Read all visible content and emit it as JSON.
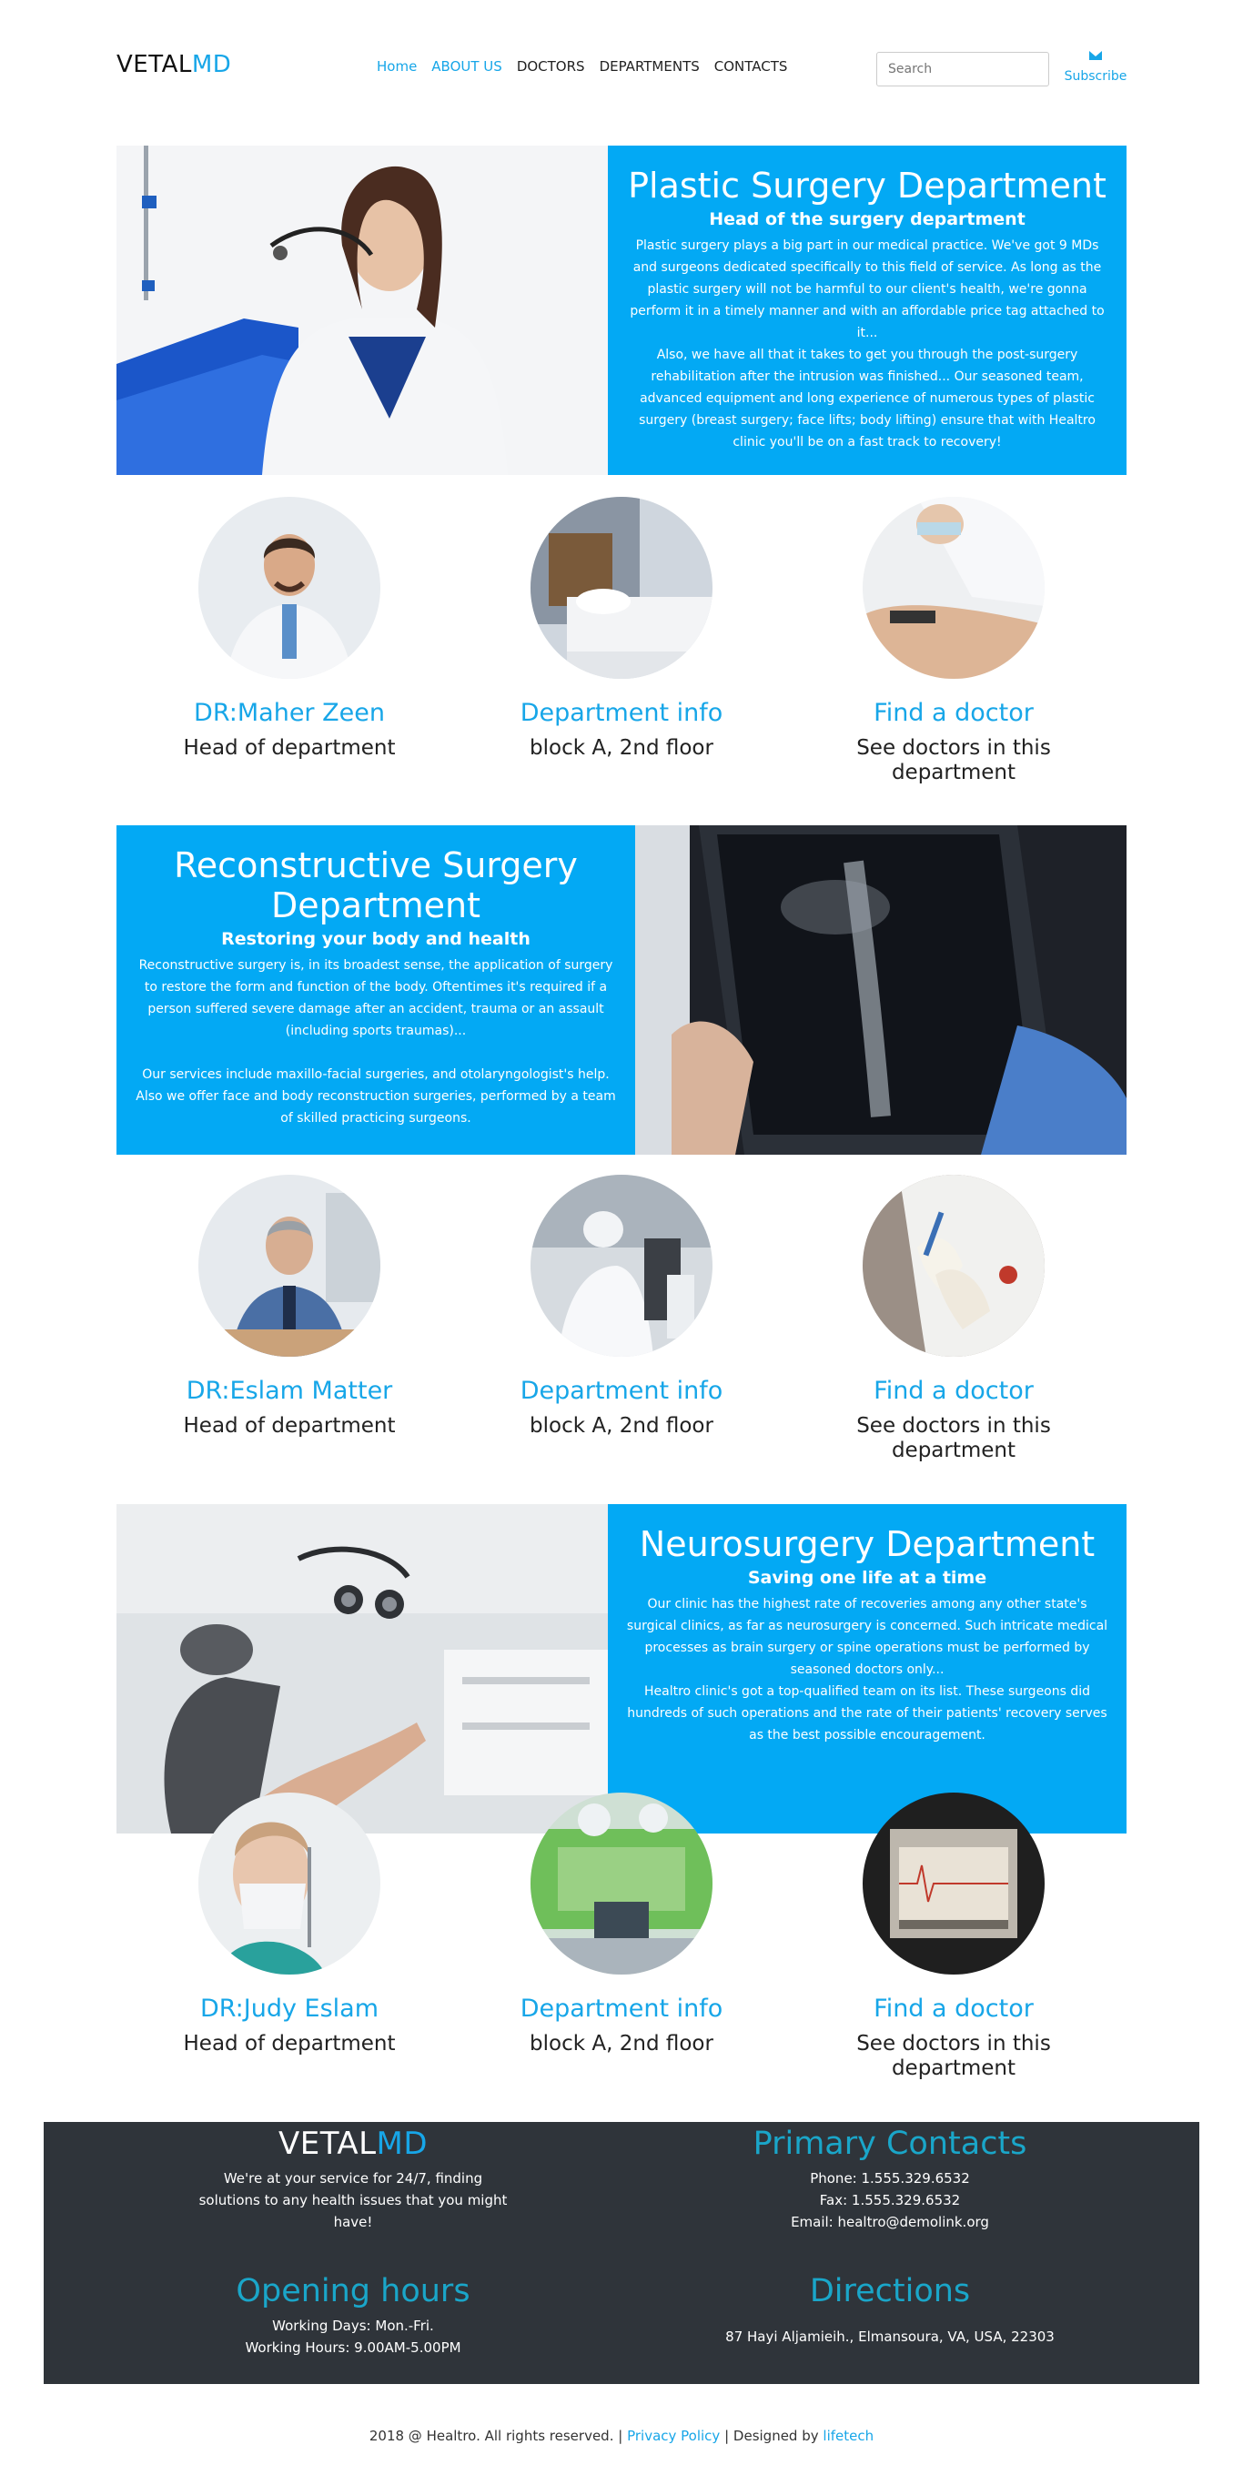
{
  "header": {
    "logo_a": "VETAL",
    "logo_b": "MD",
    "nav": [
      "Home",
      "ABOUT US",
      "DOCTORS",
      "DEPARTMENTS",
      "CONTACTS"
    ],
    "search_placeholder": "Search",
    "subscribe": "Subscribe"
  },
  "departments": [
    {
      "title": "Plastic Surgery Department",
      "subtitle": "Head of the surgery department",
      "para1": "Plastic surgery plays a big part in our medical practice. We've got 9 MDs and surgeons dedicated specifically to this field of service. As long as the plastic surgery will not be harmful to our client's health, we're gonna perform it in a timely manner and with an affordable price tag attached to it...",
      "para2": "Also, we have all that it takes to get you through the post-surgery rehabilitation after the intrusion was finished... Our seasoned team, advanced equipment and long experience of numerous types of plastic surgery (breast surgery; face lifts; body lifting) ensure that with Healtro clinic you'll be on a fast track to recovery!",
      "doctor": "DR:Maher Zeen",
      "doctor_role": "Head of department",
      "info_title": "Department info",
      "info_text": "block A, 2nd floor",
      "find_title": "Find a doctor",
      "find_text": "See doctors in this department"
    },
    {
      "title": "Reconstructive Surgery Department",
      "subtitle": "Restoring your body and health",
      "para1": "Reconstructive surgery is, in its broadest sense, the application of surgery to restore the form and function of the body. Oftentimes it's required if a person suffered severe damage after an accident, trauma or an assault (including sports traumas)...",
      "para2": "Our services include maxillo-facial surgeries, and otolaryngologist's help. Also we offer face and body reconstruction surgeries, performed by a team of skilled practicing surgeons.",
      "doctor": "DR:Eslam Matter",
      "doctor_role": "Head of department",
      "info_title": "Department info",
      "info_text": "block A, 2nd floor",
      "find_title": "Find a doctor",
      "find_text": "See doctors in this department"
    },
    {
      "title": "Neurosurgery Department",
      "subtitle": "Saving one life at a time",
      "para1": "Our clinic has the highest rate of recoveries among any other state's surgical clinics, as far as neurosurgery is concerned. Such intricate medical processes as brain surgery or spine operations must be performed by seasoned doctors only...",
      "para2": "Healtro clinic's got a top-qualified team on its list. These surgeons did hundreds of such operations and the rate of their patients' recovery serves as the best possible encouragement.",
      "doctor": "DR:Judy Eslam",
      "doctor_role": "Head of department",
      "info_title": "Department info",
      "info_text": "block A, 2nd floor",
      "find_title": "Find a doctor",
      "find_text": "See doctors in this department"
    }
  ],
  "footer": {
    "logo_a": "VETAL",
    "logo_b": "MD",
    "about": "We're at your service for 24/7, finding solutions to any health issues that you might have!",
    "contacts_title": "Primary Contacts",
    "phone": "Phone: 1.555.329.6532",
    "fax": "Fax: 1.555.329.6532",
    "email": "Email: healtro@demolink.org",
    "hours_title": "Opening hours",
    "days": "Working Days: Mon.-Fri.",
    "hours": "Working Hours: 9.00AM-5.00PM",
    "directions_title": "Directions",
    "address": "87 Hayi Aljamieih., Elmansoura, VA, USA, 22303"
  },
  "credits": {
    "text": "2018 @ Healtro. All rights reserved. |",
    "privacy": "Privacy Policy",
    "designed": "| Designed by",
    "designer": "lifetech"
  },
  "colors": {
    "accent": "#03a9f4",
    "footer_bg": "#2f343a",
    "footer_title": "#1aa6c9"
  }
}
